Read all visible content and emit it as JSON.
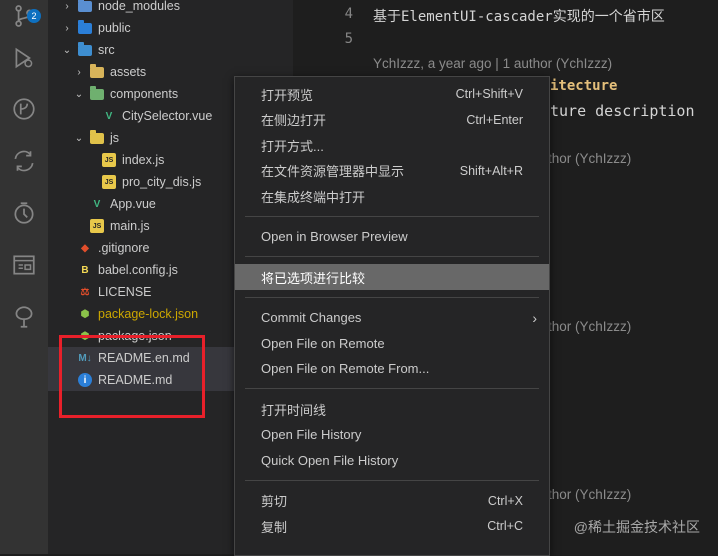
{
  "activity_bar": {
    "badge_count": "2",
    "icons": [
      "source-control-icon",
      "debug-icon",
      "git-graph-icon",
      "remote-icon",
      "timeline-icon",
      "extensions-icon",
      "tree-icon"
    ]
  },
  "explorer": {
    "rows": [
      {
        "label": "node_modules",
        "type": "folder",
        "chevron": "›",
        "indent": 1,
        "color": "#5a8fd1"
      },
      {
        "label": "public",
        "type": "folder",
        "chevron": "›",
        "indent": 1,
        "color": "#2b7fd8"
      },
      {
        "label": "src",
        "type": "folder",
        "chevron": "⌄",
        "indent": 1,
        "color": "#3e8ed0"
      },
      {
        "label": "assets",
        "type": "folder",
        "chevron": "›",
        "indent": 2,
        "color": "#d8b45a"
      },
      {
        "label": "components",
        "type": "folder",
        "chevron": "⌄",
        "indent": 2,
        "color": "#6fb06f"
      },
      {
        "label": "CitySelector.vue",
        "type": "vue",
        "indent": 3
      },
      {
        "label": "js",
        "type": "folder",
        "chevron": "⌄",
        "indent": 2,
        "color": "#e0c24a"
      },
      {
        "label": "index.js",
        "type": "js",
        "indent": 3
      },
      {
        "label": "pro_city_dis.js",
        "type": "js",
        "indent": 3
      },
      {
        "label": "App.vue",
        "type": "vue",
        "indent": 2
      },
      {
        "label": "main.js",
        "type": "js",
        "indent": 2
      },
      {
        "label": ".gitignore",
        "type": "git",
        "indent": 1
      },
      {
        "label": "babel.config.js",
        "type": "babel",
        "indent": 1
      },
      {
        "label": "LICENSE",
        "type": "license",
        "indent": 1
      },
      {
        "label": "package-lock.json",
        "type": "npm",
        "indent": 1,
        "status": "modified"
      },
      {
        "label": "package.json",
        "type": "npm",
        "indent": 1
      },
      {
        "label": "README.en.md",
        "type": "md",
        "indent": 1,
        "selected": true
      },
      {
        "label": "README.md",
        "type": "info",
        "indent": 1,
        "selected": true
      }
    ]
  },
  "editor": {
    "lines": [
      {
        "num": "4",
        "text": "基于ElementUI-cascader实现的一个省市区"
      },
      {
        "num": "5",
        "text": ""
      }
    ],
    "blame_top": "YchIzzz, a year ago | 1 author (YchIzzz)",
    "code_fragment_1": "itecture",
    "code_fragment_2": "ture description",
    "blame_fragments": [
      "thor (YchIzzz)",
      "thor (YchIzzz)",
      "thor (YchIzzz)"
    ]
  },
  "context_menu": {
    "groups": [
      [
        {
          "label": "打开预览",
          "shortcut": "Ctrl+Shift+V"
        },
        {
          "label": "在侧边打开",
          "shortcut": "Ctrl+Enter"
        },
        {
          "label": "打开方式...",
          "shortcut": ""
        },
        {
          "label": "在文件资源管理器中显示",
          "shortcut": "Shift+Alt+R"
        },
        {
          "label": "在集成终端中打开",
          "shortcut": ""
        }
      ],
      [
        {
          "label": "Open in Browser Preview",
          "shortcut": ""
        }
      ],
      [
        {
          "label": "将已选项进行比较",
          "shortcut": "",
          "highlighted": true
        }
      ],
      [
        {
          "label": "Commit Changes",
          "shortcut": "",
          "submenu": true
        },
        {
          "label": "Open File on Remote",
          "shortcut": ""
        },
        {
          "label": "Open File on Remote From...",
          "shortcut": ""
        }
      ],
      [
        {
          "label": "打开时间线",
          "shortcut": ""
        },
        {
          "label": "Open File History",
          "shortcut": ""
        },
        {
          "label": "Quick Open File History",
          "shortcut": ""
        }
      ],
      [
        {
          "label": "剪切",
          "shortcut": "Ctrl+X"
        },
        {
          "label": "复制",
          "shortcut": "Ctrl+C"
        }
      ]
    ]
  },
  "watermark": "@稀土掘金技术社区",
  "colors": {
    "annotation_box": "#e8202a",
    "menu_highlight": "#686868",
    "modified": "#cca700",
    "untracked": "#73c991"
  }
}
